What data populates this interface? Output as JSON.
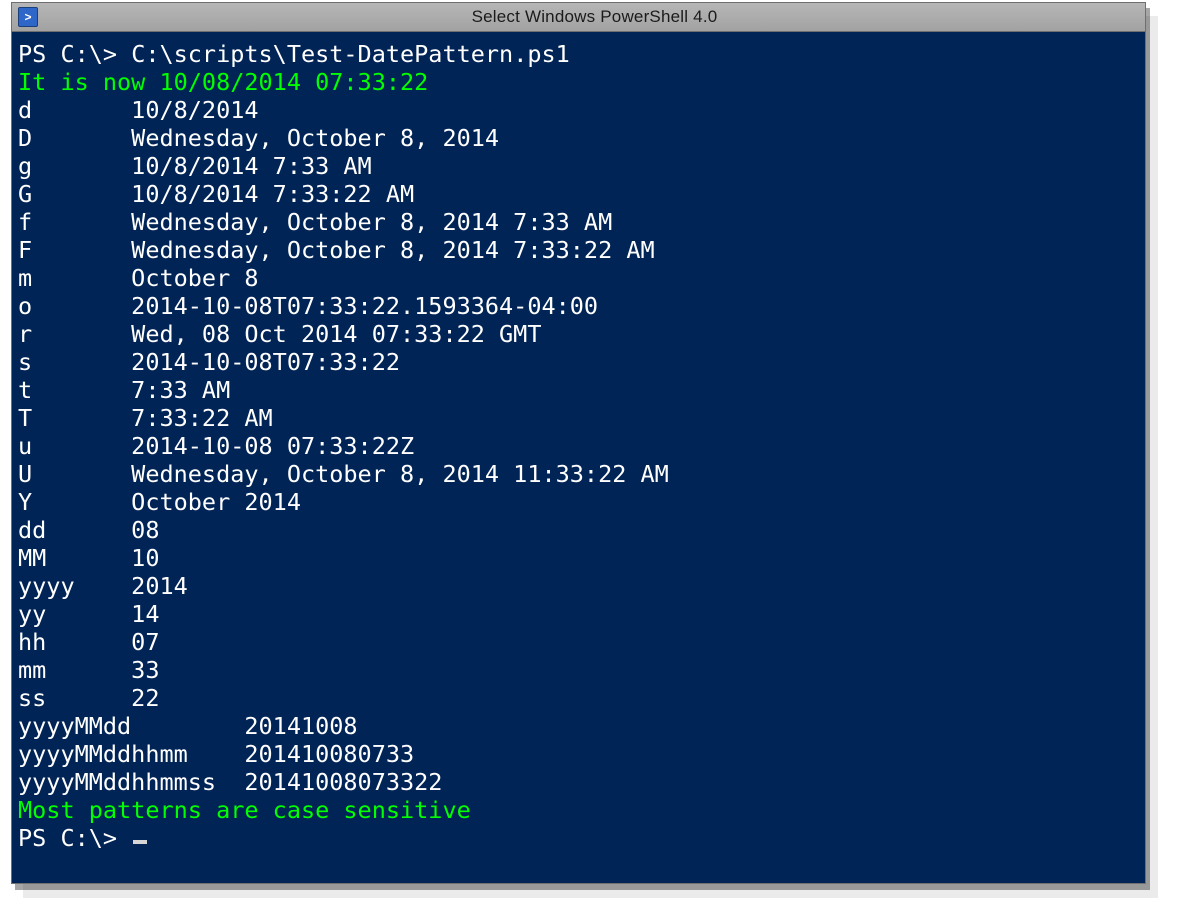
{
  "window": {
    "title": "Select Windows PowerShell 4.0",
    "icon_name": "powershell-icon",
    "icon_glyph": ">"
  },
  "console": {
    "prompt": "PS C:\\>",
    "command": "C:\\scripts\\Test-DatePattern.ps1",
    "status_line": "It is now 10/08/2014 07:33:22",
    "rows": [
      {
        "pattern": "d",
        "value": "10/8/2014"
      },
      {
        "pattern": "D",
        "value": "Wednesday, October 8, 2014"
      },
      {
        "pattern": "g",
        "value": "10/8/2014 7:33 AM"
      },
      {
        "pattern": "G",
        "value": "10/8/2014 7:33:22 AM"
      },
      {
        "pattern": "f",
        "value": "Wednesday, October 8, 2014 7:33 AM"
      },
      {
        "pattern": "F",
        "value": "Wednesday, October 8, 2014 7:33:22 AM"
      },
      {
        "pattern": "m",
        "value": "October 8"
      },
      {
        "pattern": "o",
        "value": "2014-10-08T07:33:22.1593364-04:00"
      },
      {
        "pattern": "r",
        "value": "Wed, 08 Oct 2014 07:33:22 GMT"
      },
      {
        "pattern": "s",
        "value": "2014-10-08T07:33:22"
      },
      {
        "pattern": "t",
        "value": "7:33 AM"
      },
      {
        "pattern": "T",
        "value": "7:33:22 AM"
      },
      {
        "pattern": "u",
        "value": "2014-10-08 07:33:22Z"
      },
      {
        "pattern": "U",
        "value": "Wednesday, October 8, 2014 11:33:22 AM"
      },
      {
        "pattern": "Y",
        "value": "October 2014"
      },
      {
        "pattern": "dd",
        "value": "08"
      },
      {
        "pattern": "MM",
        "value": "10"
      },
      {
        "pattern": "yyyy",
        "value": "2014"
      },
      {
        "pattern": "yy",
        "value": "14"
      },
      {
        "pattern": "hh",
        "value": "07"
      },
      {
        "pattern": "mm",
        "value": "33"
      },
      {
        "pattern": "ss",
        "value": "22"
      },
      {
        "pattern": "yyyyMMdd",
        "value": "20141008"
      },
      {
        "pattern": "yyyyMMddhhmm",
        "value": "201410080733"
      },
      {
        "pattern": "yyyyMMddhhmmss",
        "value": "20141008073322"
      }
    ],
    "footer_note": "Most patterns are case sensitive",
    "final_prompt": "PS C:\\>"
  },
  "layout": {
    "short_col": 8,
    "long_col": 16
  }
}
